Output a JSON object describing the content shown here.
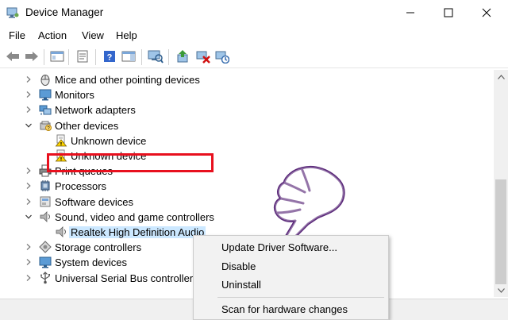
{
  "window": {
    "title": "Device Manager",
    "controls": {
      "minimize": "minimize",
      "maximize": "maximize",
      "close": "close"
    }
  },
  "menu": {
    "items": [
      "File",
      "Action",
      "View",
      "Help"
    ]
  },
  "tree": {
    "rows": [
      {
        "label": "Mice and other pointing devices",
        "icon": "mouse-icon",
        "expanded": false,
        "level": 0
      },
      {
        "label": "Monitors",
        "icon": "monitor-icon",
        "expanded": false,
        "level": 0
      },
      {
        "label": "Network adapters",
        "icon": "network-adapter-icon",
        "expanded": false,
        "level": 0
      },
      {
        "label": "Other devices",
        "icon": "other-devices-icon",
        "expanded": true,
        "level": 0
      },
      {
        "label": "Unknown device",
        "icon": "unknown-device-warning-icon",
        "level": 1
      },
      {
        "label": "Unknown device",
        "icon": "unknown-device-warning-icon",
        "level": 1
      },
      {
        "label": "Print queues",
        "icon": "printer-icon",
        "expanded": false,
        "level": 0
      },
      {
        "label": "Processors",
        "icon": "processor-icon",
        "expanded": false,
        "level": 0
      },
      {
        "label": "Software devices",
        "icon": "software-device-icon",
        "expanded": false,
        "level": 0
      },
      {
        "label": "Sound, video and game controllers",
        "icon": "speaker-icon",
        "expanded": true,
        "level": 0
      },
      {
        "label": "Realtek High Definition Audio",
        "icon": "speaker-icon",
        "level": 1,
        "selected": true
      },
      {
        "label": "Storage controllers",
        "icon": "storage-icon",
        "expanded": false,
        "level": 0
      },
      {
        "label": "System devices",
        "icon": "system-device-icon",
        "expanded": false,
        "level": 0
      },
      {
        "label": "Universal Serial Bus controllers",
        "icon": "usb-icon",
        "expanded": false,
        "level": 0
      }
    ]
  },
  "context_menu": {
    "items": [
      "Update Driver Software...",
      "Disable",
      "Uninstall",
      "Scan for hardware changes"
    ]
  },
  "colors": {
    "highlight_box": "#e8101e",
    "selection": "#cce8ff",
    "hand_cursor": "#5b2a7a"
  }
}
